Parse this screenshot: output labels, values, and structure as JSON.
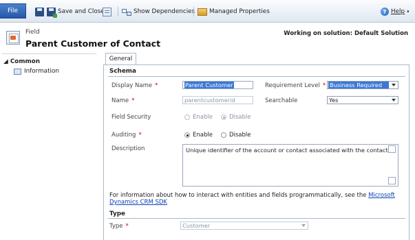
{
  "toolbar": {
    "file_label": "File",
    "save_close_label": "Save and Close",
    "show_dependencies_label": "Show Dependencies",
    "managed_properties_label": "Managed Properties",
    "help_label": "Help",
    "help_caret": "▾"
  },
  "header": {
    "kind": "Field",
    "title": "Parent Customer of Contact",
    "solution": "Working on solution: Default Solution"
  },
  "nav": {
    "group": "◢ Common",
    "items": [
      {
        "label": "Information"
      }
    ]
  },
  "tabs": [
    {
      "label": "General"
    }
  ],
  "schema": {
    "title": "Schema",
    "display_name_label": "Display Name",
    "display_name_value": "Parent Customer",
    "requirement_label": "Requirement Level",
    "requirement_value": "Business Required",
    "name_label": "Name",
    "name_value": "parentcustomerid",
    "searchable_label": "Searchable",
    "searchable_value": "Yes",
    "field_security_label": "Field Security",
    "field_security_options": [
      "Enable",
      "Disable"
    ],
    "field_security_selected": "Disable",
    "auditing_label": "Auditing",
    "auditing_options": [
      "Enable",
      "Disable"
    ],
    "auditing_selected": "Enable",
    "description_label": "Description",
    "description_value": "Unique identifier of the account or contact associated with the contact.",
    "required_marker": "*"
  },
  "info": {
    "text": "For information about how to interact with entities and fields programmatically, see the ",
    "link_part1": "Microsoft",
    "link_part2": "Dynamics CRM SDK"
  },
  "type_section": {
    "title": "Type",
    "type_label": "Type",
    "type_value": "Customer"
  },
  "colors": {
    "accent": "#3a78d6",
    "required": "#cc0000",
    "link": "#0b41b5",
    "file_tab": "#2f65b8"
  }
}
